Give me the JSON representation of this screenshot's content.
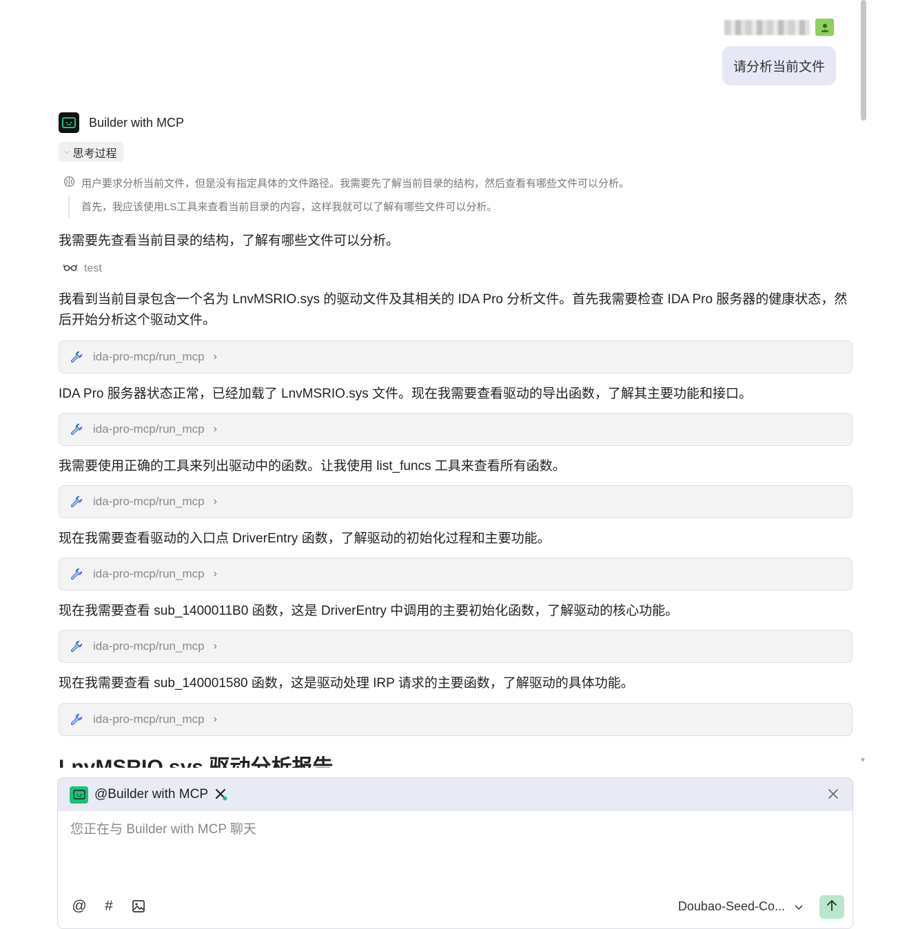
{
  "user": {
    "message": "请分析当前文件"
  },
  "assistant": {
    "name": "Builder with MCP",
    "thinking_toggle_label": "思考过程",
    "thinking_line_1": "用户要求分析当前文件，但是没有指定具体的文件路径。我需要先了解当前目录的结构，然后查看有哪些文件可以分析。",
    "thinking_line_2": "首先，我应该使用LS工具来查看当前目录的内容，这样我就可以了解有哪些文件可以分析。",
    "paragraph_1": "我需要先查看当前目录的结构，了解有哪些文件可以分析。",
    "mcp_label": "test",
    "paragraph_2": "我看到当前目录包含一个名为 LnvMSRIO.sys 的驱动文件及其相关的 IDA Pro 分析文件。首先我需要检查 IDA Pro 服务器的健康状态，然后开始分析这个驱动文件。",
    "tool_call_label": "ida-pro-mcp/run_mcp",
    "paragraph_3": "IDA Pro 服务器状态正常，已经加载了 LnvMSRIO.sys 文件。现在我需要查看驱动的导出函数，了解其主要功能和接口。",
    "paragraph_4": "我需要使用正确的工具来列出驱动中的函数。让我使用 list_funcs 工具来查看所有函数。",
    "paragraph_5": "现在我需要查看驱动的入口点 DriverEntry 函数，了解驱动的初始化过程和主要功能。",
    "paragraph_6": "现在我需要查看 sub_1400011B0 函数，这是 DriverEntry 中调用的主要初始化函数，了解驱动的核心功能。",
    "paragraph_7": "现在我需要查看 sub_140001580 函数，这是驱动处理 IRP 请求的主要函数，了解驱动的具体功能。",
    "report_title": "LnvMSRIO.sys 驱动分析报告"
  },
  "composer": {
    "agent_mention": "@Builder with MCP",
    "placeholder": "您正在与 Builder with MCP 聊天",
    "tool_at": "@",
    "tool_hash": "#",
    "model": "Doubao-Seed-Co..."
  },
  "colors": {
    "user_bubble": "#e6e8f5",
    "agent_accent": "#19c37d",
    "send_button": "#b8e6cf",
    "tool_card_bg": "#f3f3f3",
    "wrench_blue": "#3a6fd8"
  },
  "icons": [
    "user-avatar-icon",
    "bot-avatar-icon",
    "brain-icon",
    "glasses-icon",
    "wrench-icon",
    "chevron-right-icon",
    "tools-icon",
    "close-icon",
    "image-icon",
    "chevron-down-icon",
    "arrow-up-icon"
  ]
}
